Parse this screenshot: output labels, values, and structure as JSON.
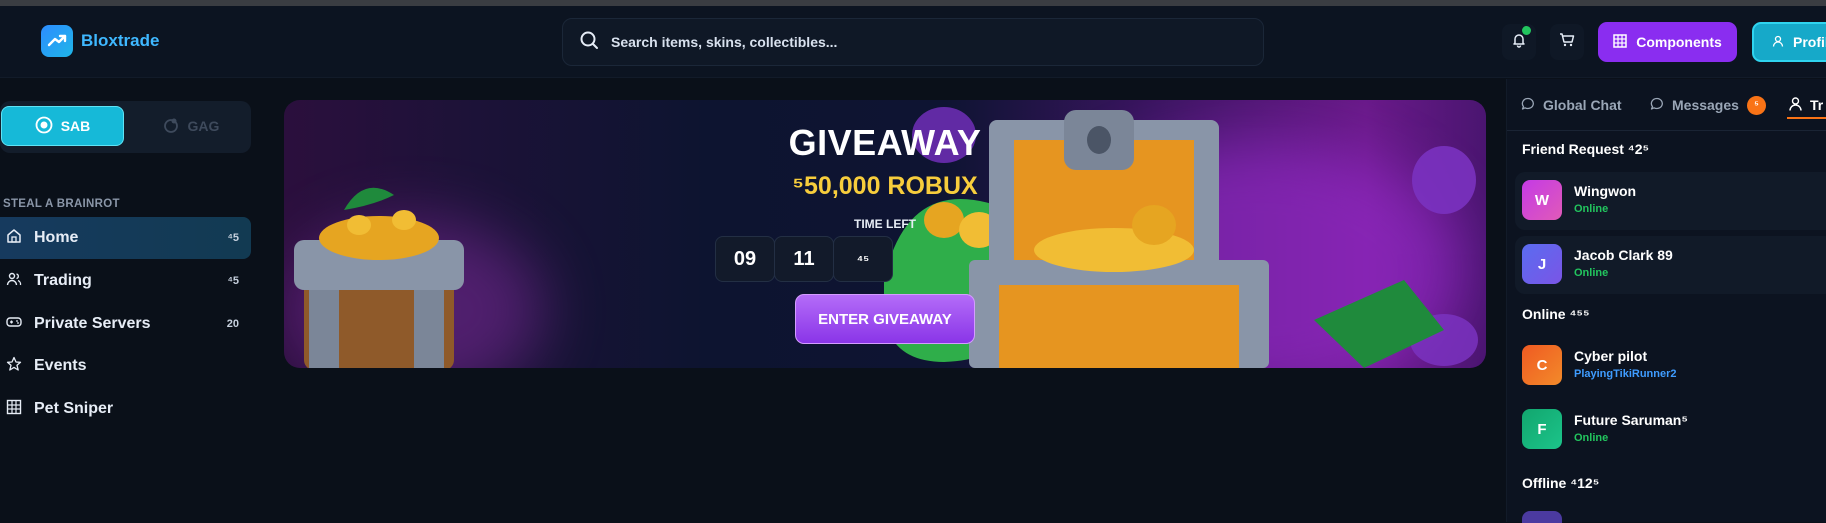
{
  "header": {
    "logo_text": "Bloxtrade",
    "search_placeholder": "Search items, skins, collectibles...",
    "components_label": "Components",
    "profile_label": "Profile"
  },
  "sidebar": {
    "toggle": {
      "sab": "SAB",
      "gag": "GAG"
    },
    "section_label": "STEAL A BRAINROT",
    "items": [
      {
        "label": "Home",
        "count": "⁴5",
        "icon": "home-icon"
      },
      {
        "label": "Trading",
        "count": "⁴5",
        "icon": "users-icon"
      },
      {
        "label": "Private Servers",
        "count": "20",
        "icon": "gamepad-icon"
      },
      {
        "label": "Events",
        "count": "",
        "icon": "star-icon"
      },
      {
        "label": "Pet Sniper",
        "count": "",
        "icon": "grid-icon"
      }
    ]
  },
  "banner": {
    "title": "GIVEAWAY",
    "prize": "⁵50,000 ROBUX",
    "time_left_label": "TIME LEFT",
    "timer": [
      "09",
      "11",
      "⁴⁵"
    ],
    "cta": "ENTER GIVEAWAY"
  },
  "right_panel": {
    "tabs": {
      "global_chat": "Global Chat",
      "messages": "Messages",
      "messages_badge": "⁵",
      "third": "Tr"
    },
    "friend_request_label": "Friend Request ⁴2⁵",
    "friend_requests": [
      {
        "initial": "W",
        "name": "Wingwon",
        "status": "Online",
        "color": "#d946ef"
      },
      {
        "initial": "J",
        "name": "Jacob Clark 89",
        "status": "Online",
        "color": "#6366f1"
      }
    ],
    "online_label": "Online ⁴⁵⁵",
    "online": [
      {
        "initial": "C",
        "name": "Cyber pilot",
        "status": "PlayingTikiRunner2",
        "color": "#f97316"
      },
      {
        "initial": "F",
        "name": "Future Saruman⁵",
        "status": "Online",
        "color": "#10b981"
      }
    ],
    "offline_label": "Offline ⁴12⁵"
  },
  "colors": {
    "accent_purple": "#8a2df0",
    "accent_cyan": "#16a9c9",
    "online_green": "#22c55e",
    "prize_gold": "#f7cd3c"
  }
}
